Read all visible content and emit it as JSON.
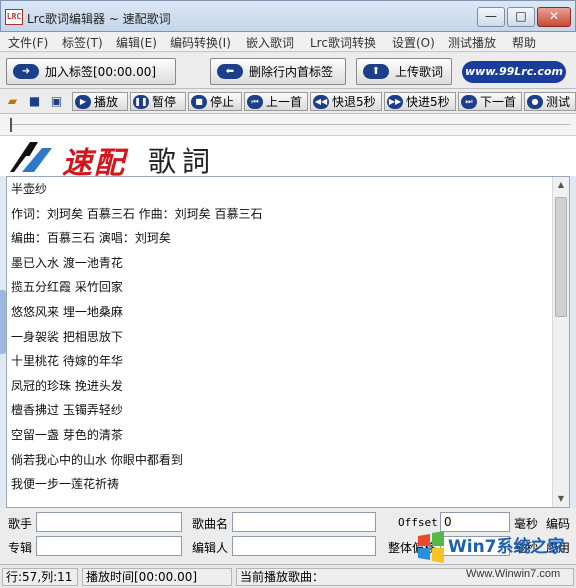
{
  "window": {
    "title": "Lrc歌词编辑器 ~ 速配歌词",
    "app_icon_text": "LRC",
    "minimize": "—",
    "maximize": "□",
    "close": "✕"
  },
  "menu": [
    "文件(F)",
    "标签(T)",
    "编辑(E)",
    "编码转换(I)",
    "嵌入歌词",
    "Lrc歌词转换",
    "设置(O)",
    "测试播放",
    "帮助"
  ],
  "topbar": {
    "add_tag": "加入标签[00:00.00]",
    "delete_tag": "删除行内首标签",
    "upload": "上传歌词",
    "site": "www.99Lrc.com"
  },
  "toolbar": {
    "play": "播放",
    "pause": "暂停",
    "stop": "停止",
    "prev": "上一首",
    "rewind": "快退5秒",
    "forward": "快进5秒",
    "next": "下一首",
    "test": "测试"
  },
  "banner": {
    "brand_red": "速配",
    "brand_black": "歌詞"
  },
  "lyrics": [
    "半壶纱",
    "作词：刘珂矣  百慕三石  作曲：刘珂矣  百慕三石",
    "编曲：百慕三石  演唱：刘珂矣",
    "墨已入水  渡一池青花",
    "揽五分红霞  采竹回家",
    "悠悠风来  埋一地桑麻",
    "一身袈裟  把相思放下",
    "十里桃花  待嫁的年华",
    "凤冠的珍珠  挽进头发",
    "檀香拂过  玉镯弄轻纱",
    "空留一盏  芽色的清茶",
    "倘若我心中的山水  你眼中都看到",
    "我便一步一莲花祈祷"
  ],
  "fields": {
    "singer_label": "歌手",
    "song_label": "歌曲名",
    "offset_label": "Offset",
    "offset_value": "0",
    "ms_label": "毫秒",
    "encoding_label": "编码",
    "album_label": "专辑",
    "editor_label": "编辑人",
    "overall_offset_label": "整体偏移",
    "ms_label2": "毫秒",
    "apply_label": "应用"
  },
  "status": {
    "position": "行:57,列:11",
    "play_time": "播放时间[00:00.00]",
    "current_song": "当前播放歌曲："
  },
  "watermark": {
    "title": "Win7系统之家",
    "url": "Www.Winwin7.com"
  }
}
